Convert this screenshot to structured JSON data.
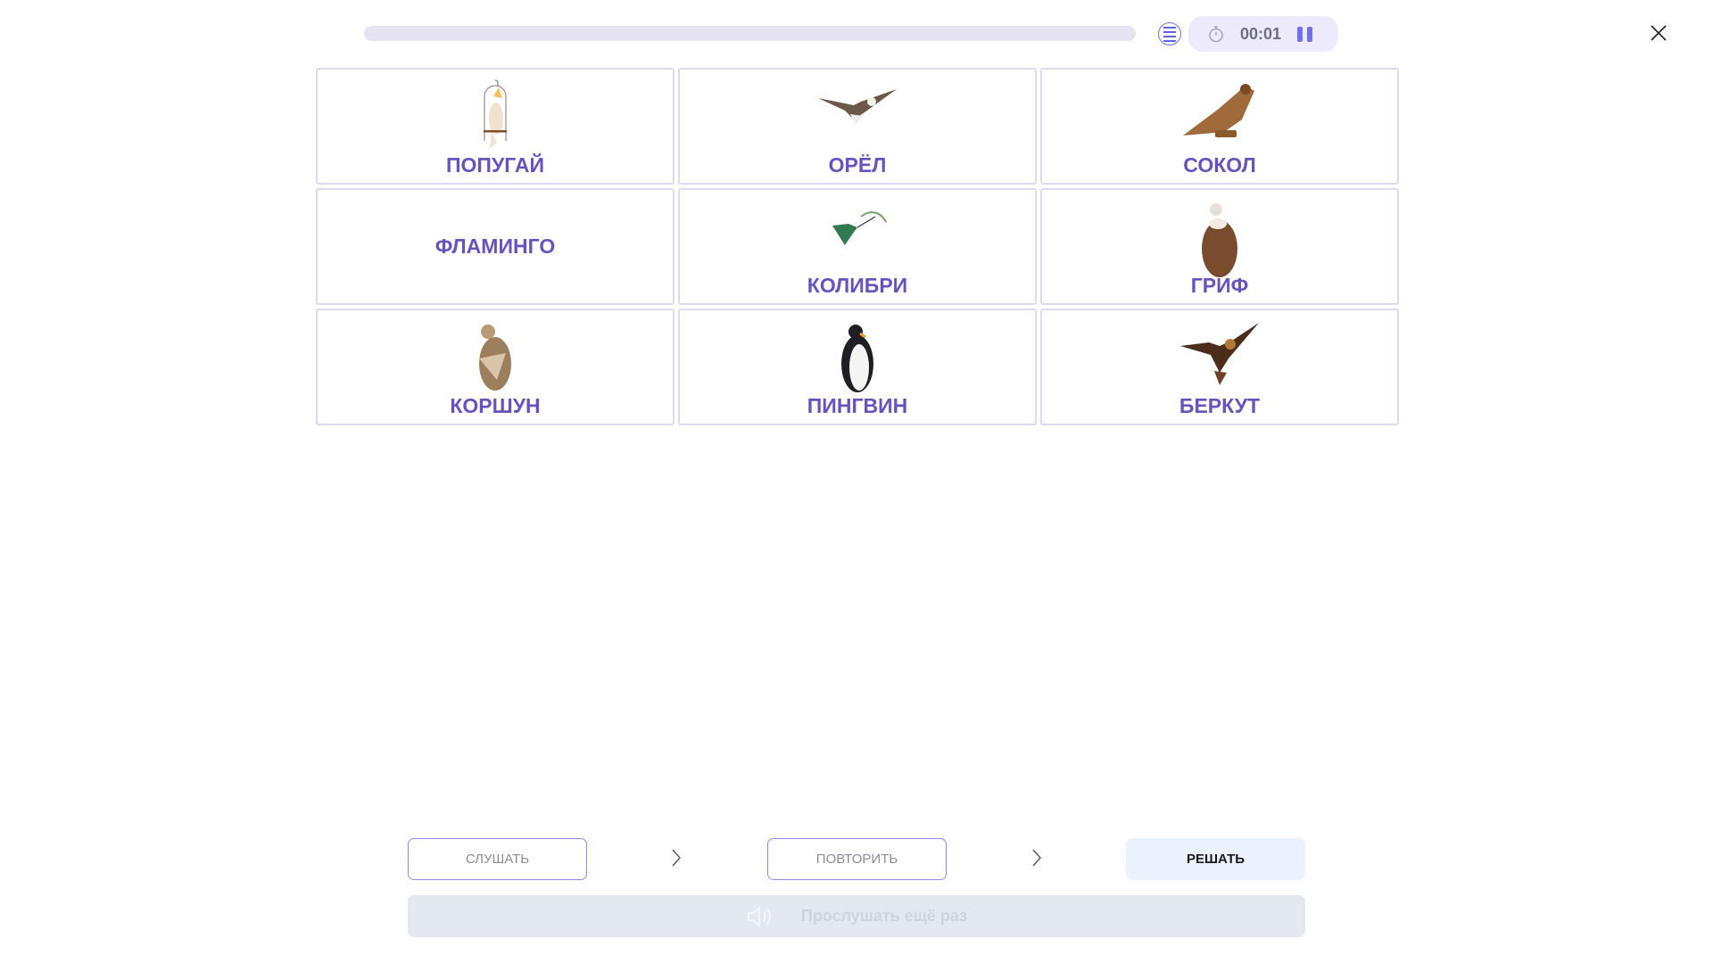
{
  "header": {
    "progress": 0,
    "timer": "00:01"
  },
  "cards": [
    {
      "label": "ПОПУГАЙ",
      "icon": "parrot-image"
    },
    {
      "label": "ОРЁЛ",
      "icon": "eagle-image"
    },
    {
      "label": "СОКОЛ",
      "icon": "falcon-image"
    },
    {
      "label": "ФЛАМИНГО",
      "icon": null
    },
    {
      "label": "КОЛИБРИ",
      "icon": "hummingbird-image"
    },
    {
      "label": "ГРИФ",
      "icon": "vulture-image"
    },
    {
      "label": "КОРШУН",
      "icon": "kite-image"
    },
    {
      "label": "ПИНГВИН",
      "icon": "penguin-image"
    },
    {
      "label": "БЕРКУТ",
      "icon": "golden-eagle-image"
    }
  ],
  "steps": {
    "listen": "СЛУШАТЬ",
    "repeat": "ПОВТОРИТЬ",
    "solve": "РЕШАТЬ"
  },
  "replay": {
    "label": "Прослушать ещё раз"
  },
  "colors": {
    "accent": "#6753bf",
    "border": "#dcd9f1"
  }
}
